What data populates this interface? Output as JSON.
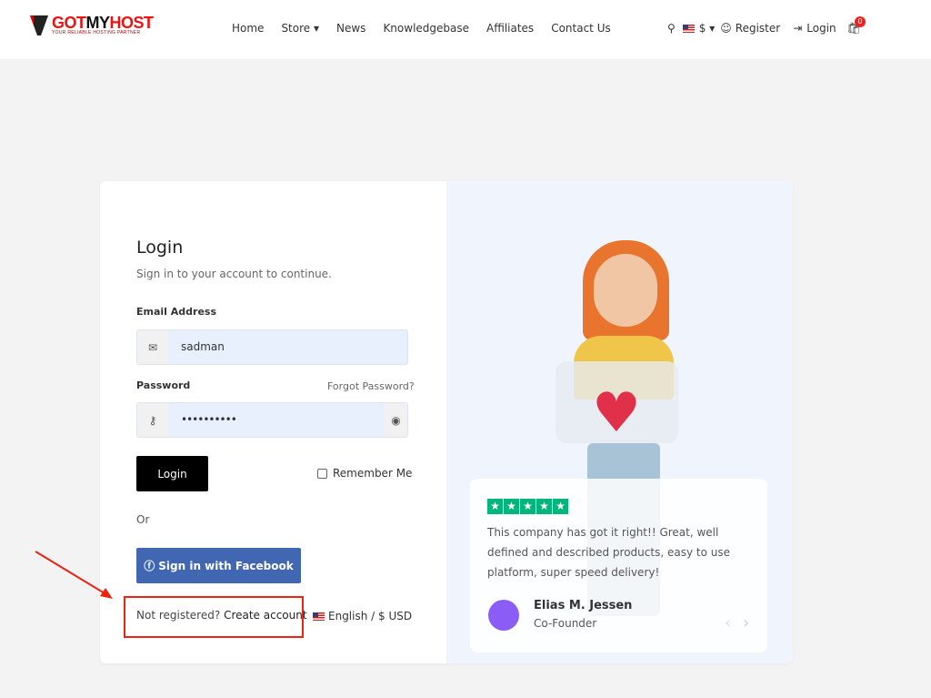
{
  "header": {
    "logo": "GOTMYHOST",
    "tagline": "YOUR RELIABLE HOSTING PARTNER",
    "nav": [
      "Home",
      "Store",
      "News",
      "Knowledgebase",
      "Affiliates",
      "Contact Us"
    ],
    "currency": "$",
    "register": "Register",
    "login": "Login",
    "cart_count": "0"
  },
  "form": {
    "title": "Login",
    "subtitle": "Sign in to your account to continue.",
    "email_label": "Email Address",
    "email_value": "sadman",
    "password_label": "Password",
    "forgot": "Forgot Password?",
    "password_value": "••••••••••",
    "login_button": "Login",
    "remember": "Remember Me",
    "or": "Or",
    "facebook": "Sign in with Facebook",
    "not_registered": "Not registered?",
    "create_account": "Create account",
    "language": "English / $ USD"
  },
  "review": {
    "text": "This company has got it right!! Great, well defined and described products, easy to use platform, super speed delivery!",
    "name": "Elias M. Jessen",
    "role": "Co-Founder",
    "rating": 5
  },
  "colors": {
    "accent": "#000000",
    "facebook": "#4267b2",
    "stars": "#00b67a",
    "highlight": "#e21"
  }
}
